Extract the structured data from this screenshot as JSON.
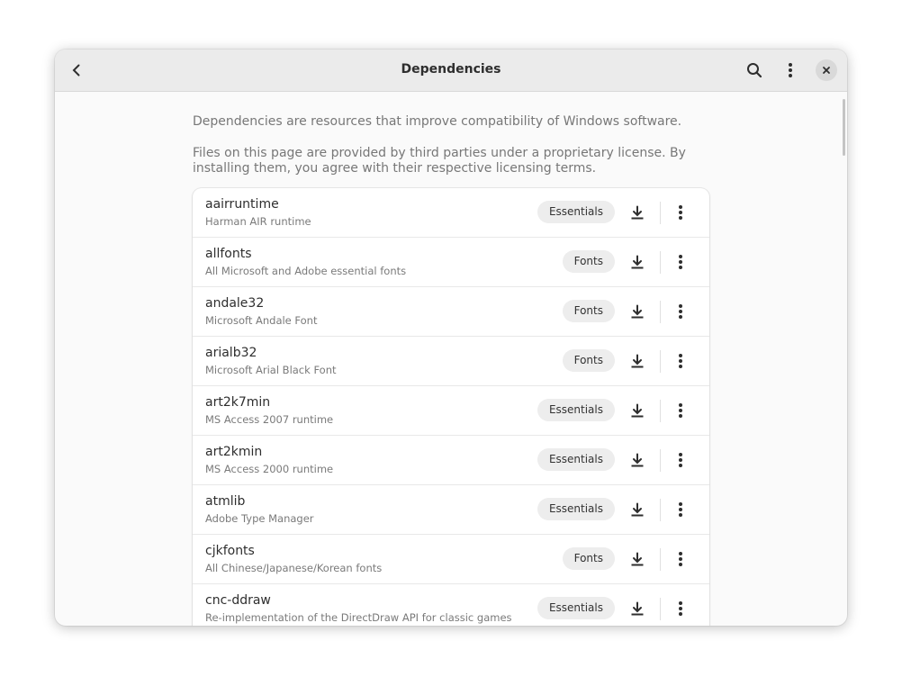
{
  "header": {
    "title": "Dependencies",
    "back_icon": "chevron-left-icon",
    "search_icon": "search-icon",
    "menu_icon": "vertical-dots-icon",
    "close_icon": "close-icon"
  },
  "intro": {
    "line1": "Dependencies are resources that improve compatibility of Windows software.",
    "line2": "Files on this page are provided by third parties under a proprietary license. By installing them, you agree with their respective licensing terms."
  },
  "items": [
    {
      "name": "aairruntime",
      "description": "Harman AIR runtime",
      "category": "Essentials"
    },
    {
      "name": "allfonts",
      "description": "All Microsoft and Adobe essential fonts",
      "category": "Fonts"
    },
    {
      "name": "andale32",
      "description": "Microsoft Andale Font",
      "category": "Fonts"
    },
    {
      "name": "arialb32",
      "description": "Microsoft Arial Black Font",
      "category": "Fonts"
    },
    {
      "name": "art2k7min",
      "description": "MS Access 2007 runtime",
      "category": "Essentials"
    },
    {
      "name": "art2kmin",
      "description": "MS Access 2000 runtime",
      "category": "Essentials"
    },
    {
      "name": "atmlib",
      "description": "Adobe Type Manager",
      "category": "Essentials"
    },
    {
      "name": "cjkfonts",
      "description": "All Chinese/Japanese/Korean fonts",
      "category": "Fonts"
    },
    {
      "name": "cnc-ddraw",
      "description": "Re-implementation of the DirectDraw API for classic games",
      "category": "Essentials"
    }
  ]
}
